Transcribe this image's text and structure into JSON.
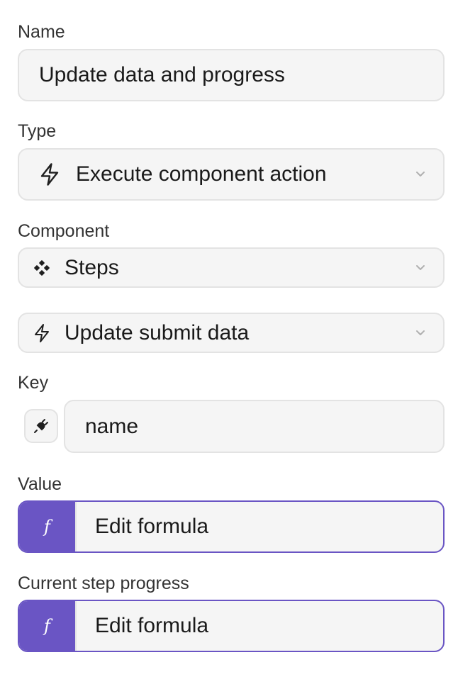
{
  "name": {
    "label": "Name",
    "value": "Update data and progress"
  },
  "type": {
    "label": "Type",
    "value": "Execute component action",
    "icon": "lightning-icon"
  },
  "component": {
    "label": "Component",
    "value": "Steps",
    "icon": "steps-component-icon"
  },
  "action": {
    "value": "Update submit data",
    "icon": "lightning-icon"
  },
  "key": {
    "label": "Key",
    "value": "name",
    "icon": "plug-icon"
  },
  "value": {
    "label": "Value",
    "formula_label": "Edit formula",
    "icon": "function-icon",
    "icon_glyph": "f"
  },
  "progress": {
    "label": "Current step progress",
    "formula_label": "Edit formula",
    "icon": "function-icon",
    "icon_glyph": "f"
  },
  "colors": {
    "accent": "#6a55c4",
    "field_bg": "#f5f5f5",
    "border": "#e3e3e3"
  }
}
